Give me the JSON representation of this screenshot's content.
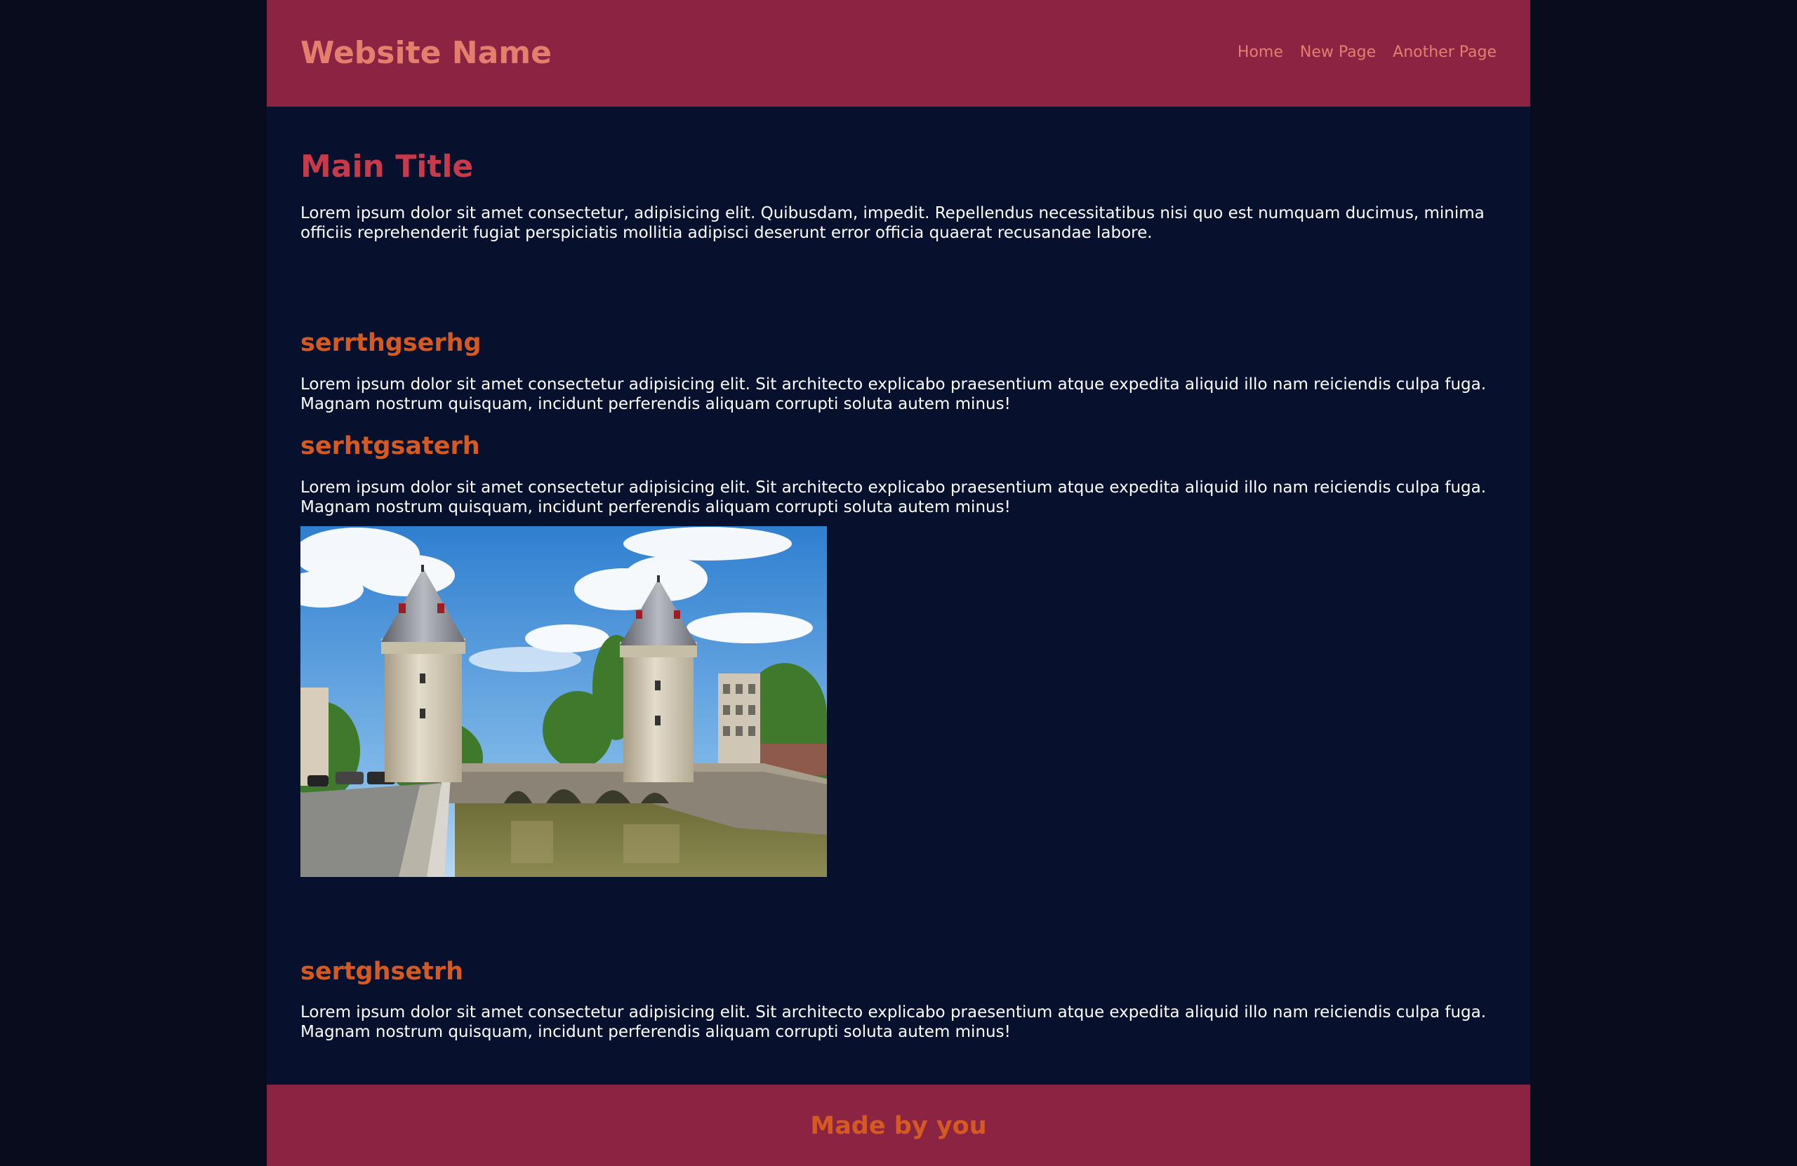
{
  "header": {
    "site_name": "Website Name",
    "nav": [
      "Home",
      "New Page",
      "Another Page"
    ]
  },
  "main": {
    "title": "Main Title",
    "intro": "Lorem ipsum dolor sit amet consectetur, adipisicing elit. Quibusdam, impedit. Repellendus necessitatibus nisi quo est numquam ducimus, minima officiis reprehenderit fugiat perspiciatis mollitia adipisci deserunt error officia quaerat recusandae labore."
  },
  "sections": [
    {
      "heading": "serrthgserhg",
      "text": "Lorem ipsum dolor sit amet consectetur adipisicing elit. Sit architecto explicabo praesentium atque expedita aliquid illo nam reiciendis culpa fuga. Magnam nostrum quisquam, incidunt perferendis aliquam corrupti soluta autem minus!"
    },
    {
      "heading": "serhtgsaterh",
      "text": "Lorem ipsum dolor sit amet consectetur adipisicing elit. Sit architecto explicabo praesentium atque expedita aliquid illo nam reiciendis culpa fuga. Magnam nostrum quisquam, incidunt perferendis aliquam corrupti soluta autem minus!"
    },
    {
      "heading": "sertghsetrh",
      "text": "Lorem ipsum dolor sit amet consectetur adipisicing elit. Sit architecto explicabo praesentium atque expedita aliquid illo nam reiciendis culpa fuga. Magnam nostrum quisquam, incidunt perferendis aliquam corrupti soluta autem minus!"
    }
  ],
  "footer": {
    "text": "Made by you"
  },
  "colors": {
    "header_bg": "#8b2342",
    "page_bg": "#07112d",
    "outer_bg": "#080c1c",
    "site_name": "#e47f6e",
    "main_title": "#c83a4a",
    "subheading": "#d55a22"
  }
}
